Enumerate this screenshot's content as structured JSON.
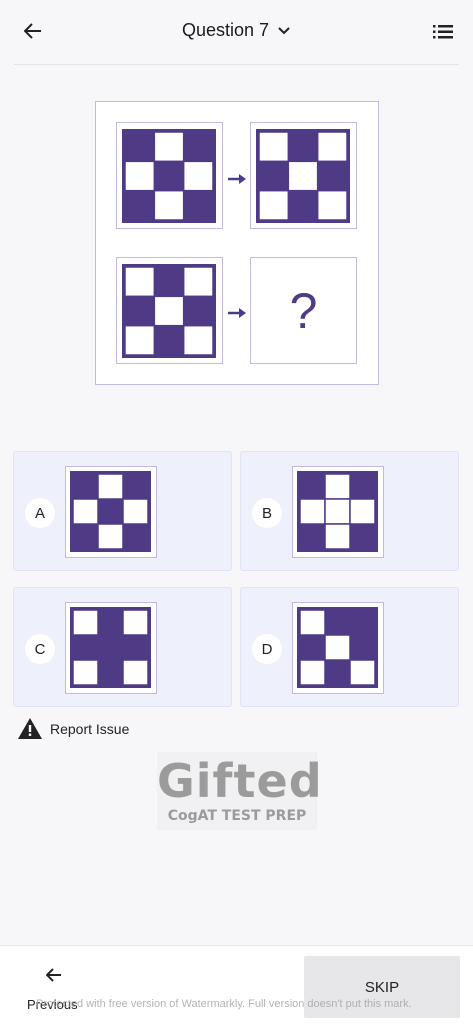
{
  "header": {
    "title": "Question 7",
    "back_icon": "arrow-left-icon",
    "dropdown_icon": "chevron-down-icon",
    "menu_icon": "list-icon"
  },
  "colors": {
    "purple": "#4e3a85",
    "border": "#c5b8e0",
    "option_bg": "#eef0fb"
  },
  "puzzle": {
    "question_mark": "?",
    "grids": {
      "top_left": [
        [
          1,
          0,
          1
        ],
        [
          0,
          1,
          0
        ],
        [
          1,
          0,
          1
        ]
      ],
      "top_right": [
        [
          0,
          1,
          0
        ],
        [
          1,
          0,
          1
        ],
        [
          0,
          1,
          0
        ]
      ],
      "bottom_left": [
        [
          0,
          1,
          0
        ],
        [
          1,
          0,
          1
        ],
        [
          0,
          1,
          0
        ]
      ]
    }
  },
  "options": [
    {
      "label": "A",
      "grid": [
        [
          1,
          0,
          1
        ],
        [
          0,
          1,
          0
        ],
        [
          1,
          0,
          1
        ]
      ]
    },
    {
      "label": "B",
      "grid": [
        [
          1,
          0,
          1
        ],
        [
          0,
          0,
          0
        ],
        [
          1,
          0,
          1
        ]
      ]
    },
    {
      "label": "C",
      "grid": [
        [
          0,
          1,
          0
        ],
        [
          1,
          1,
          1
        ],
        [
          0,
          1,
          0
        ]
      ]
    },
    {
      "label": "D",
      "grid": [
        [
          0,
          1,
          1
        ],
        [
          1,
          0,
          1
        ],
        [
          0,
          1,
          0
        ]
      ]
    }
  ],
  "report": {
    "label": "Report Issue",
    "icon": "warning-icon"
  },
  "logo": {
    "word": "Gifted",
    "subtitle": "CogAT TEST PREP"
  },
  "footer": {
    "previous_label": "Previous",
    "skip_label": "SKIP",
    "watermark": "Protected with free version of Watermarkly. Full version doesn't put this mark."
  }
}
